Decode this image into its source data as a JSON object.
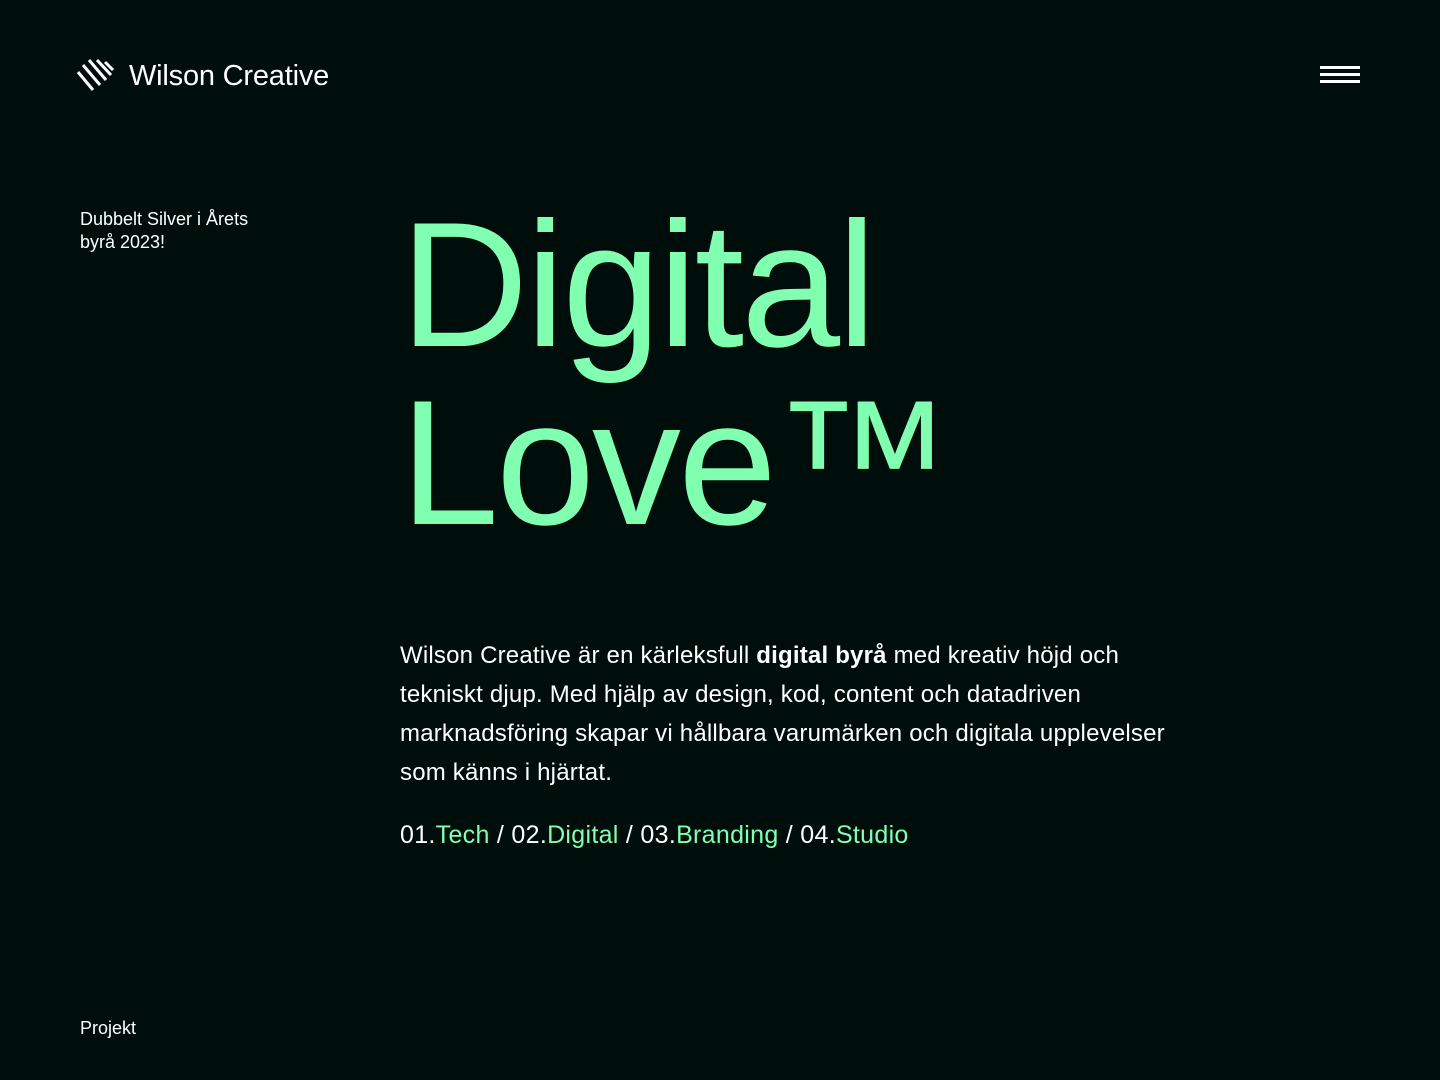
{
  "colors": {
    "background": "#000e0b",
    "accent": "#80ffb0",
    "text": "#ffffff"
  },
  "header": {
    "logo_icon": "wilson-creative-logo-icon",
    "logo_text": "Wilson Creative",
    "menu_icon": "hamburger-menu-icon"
  },
  "award": {
    "line1": "Dubbelt Silver i Årets",
    "line2": "byrå 2023!"
  },
  "hero": {
    "line1": "Digital",
    "line2": "Love™"
  },
  "intro": {
    "part1": "Wilson Creative är en kärleksfull ",
    "bold": "digital byrå",
    "part2": " med kreativ höjd och tekniskt djup. Med hjälp av design, kod, content och datadriven marknadsföring skapar vi hållbara varumärken och digitala upplevelser som känns i hjärtat."
  },
  "services": [
    {
      "number": "01.",
      "label": "Tech"
    },
    {
      "number": "02.",
      "label": "Digital"
    },
    {
      "number": "03.",
      "label": "Branding"
    },
    {
      "number": "04.",
      "label": "Studio"
    }
  ],
  "separator": " / ",
  "footer": {
    "projects_label": "Projekt"
  }
}
